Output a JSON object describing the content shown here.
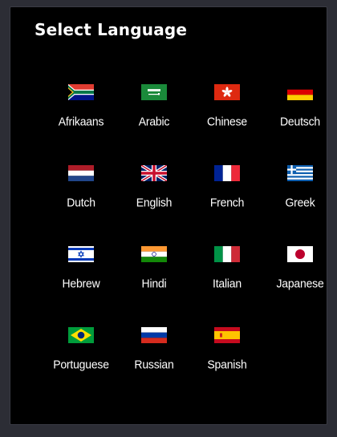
{
  "dialog": {
    "title": "Select Language"
  },
  "languages": [
    {
      "label": "Afrikaans",
      "flag_icon": "south-africa-flag-icon"
    },
    {
      "label": "Arabic",
      "flag_icon": "saudi-arabia-flag-icon"
    },
    {
      "label": "Chinese",
      "flag_icon": "hong-kong-flag-icon"
    },
    {
      "label": "Deutsch",
      "flag_icon": "germany-flag-icon"
    },
    {
      "label": "Dutch",
      "flag_icon": "netherlands-flag-icon"
    },
    {
      "label": "English",
      "flag_icon": "united-kingdom-flag-icon"
    },
    {
      "label": "French",
      "flag_icon": "france-flag-icon"
    },
    {
      "label": "Greek",
      "flag_icon": "greece-flag-icon"
    },
    {
      "label": "Hebrew",
      "flag_icon": "israel-flag-icon"
    },
    {
      "label": "Hindi",
      "flag_icon": "india-flag-icon"
    },
    {
      "label": "Italian",
      "flag_icon": "italy-flag-icon"
    },
    {
      "label": "Japanese",
      "flag_icon": "japan-flag-icon"
    },
    {
      "label": "Portuguese",
      "flag_icon": "brazil-flag-icon"
    },
    {
      "label": "Russian",
      "flag_icon": "russia-flag-icon"
    },
    {
      "label": "Spanish",
      "flag_icon": "spain-flag-icon"
    }
  ],
  "colors": {
    "page_background": "#2c2d35",
    "dialog_background": "#000000",
    "text": "#ffffff"
  }
}
